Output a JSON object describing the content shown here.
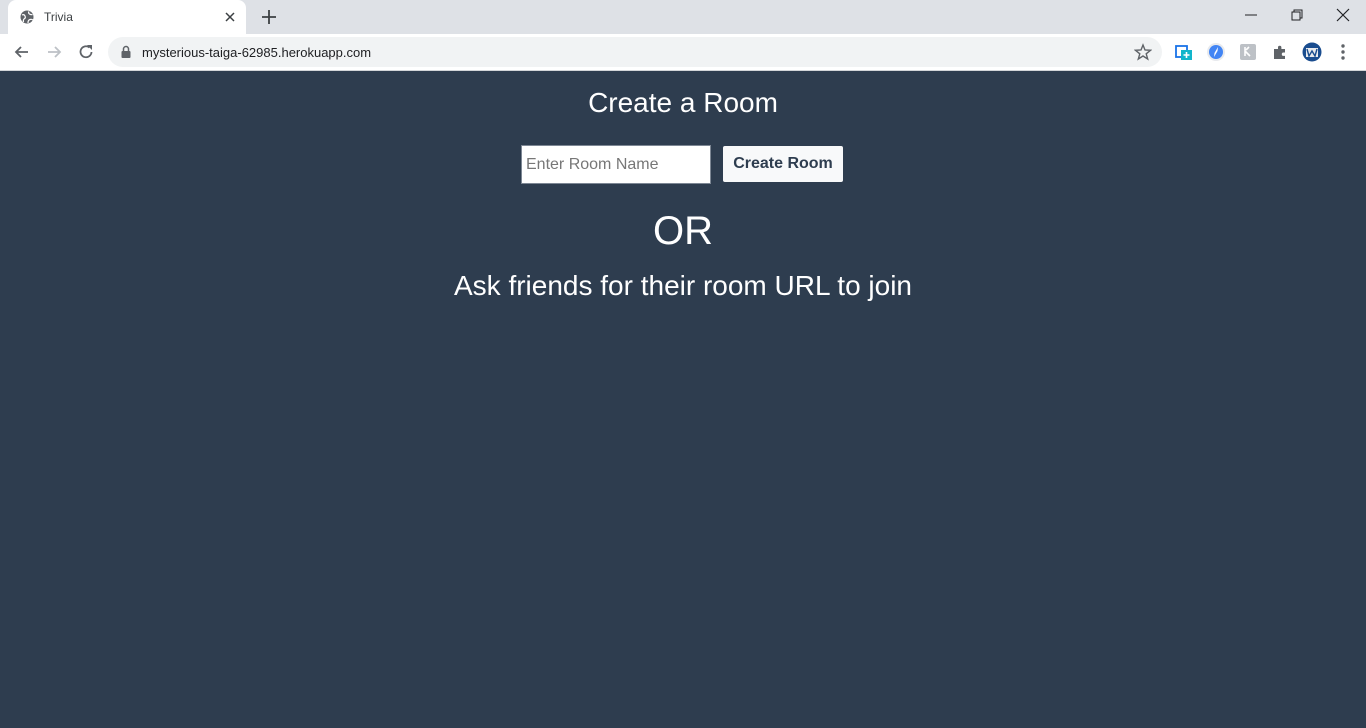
{
  "browser": {
    "tab_title": "Trivia",
    "url": "mysterious-taiga-62985.herokuapp.com"
  },
  "page": {
    "title": "Create a Room",
    "room_input_placeholder": "Enter Room Name",
    "create_button_label": "Create Room",
    "or_text": "OR",
    "join_text": "Ask friends for their room URL to join"
  },
  "colors": {
    "page_background": "#2e3d4f",
    "text": "#ffffff",
    "tab_strip": "#dee1e6"
  }
}
